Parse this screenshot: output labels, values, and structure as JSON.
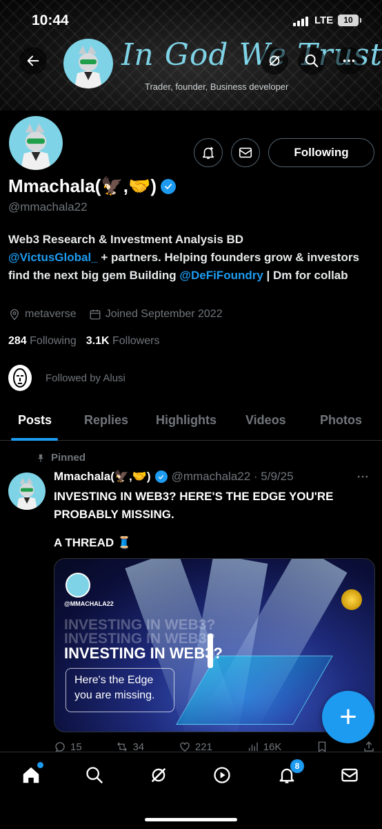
{
  "status_bar": {
    "time": "10:44",
    "network": "LTE",
    "battery": "10"
  },
  "banner": {
    "title": "In God We Trust",
    "subtitle": "Trader, founder, Business developer"
  },
  "header_actions": {
    "following_label": "Following"
  },
  "profile": {
    "name": "Mmachala(🦅,🤝)",
    "handle": "@mmachala22",
    "bio": {
      "line1": "Web3 Research & Investment Analysis BD",
      "mention1": "@VictusGlobal_",
      "text2": "+ partners. Helping founders grow & investors find the next big gem Building",
      "mention2": "@DeFiFoundry",
      "text3": "| Dm for collab"
    },
    "location": "metaverse",
    "joined": "Joined September 2022",
    "following_count": "284",
    "following_label": "Following",
    "followers_count": "3.1K",
    "followers_label": "Followers",
    "followed_by": "Followed by Alusi"
  },
  "tabs": [
    "Posts",
    "Replies",
    "Highlights",
    "Videos",
    "Photos"
  ],
  "post": {
    "pinned_label": "Pinned",
    "author": "Mmachala(🦅,🤝)",
    "handle_date": "@mmachala22 · 5/9/25",
    "text": "INVESTING IN WEB3? HERE'S THE EDGE YOU'RE PROBABLY MISSING.",
    "text2": "A THREAD 🧵",
    "media": {
      "handle": "@MMACHALA22",
      "ghost": "INVESTING IN WEB3?",
      "title": "INVESTING IN WEB3?",
      "box_line1": "Here's the Edge",
      "box_line2": "you are missing."
    },
    "replies": "15",
    "reposts": "34",
    "likes": "221",
    "views": "16K"
  },
  "fab_label": "+",
  "nav": {
    "notifications_badge": "8"
  },
  "colors": {
    "accent": "#1d9bf0",
    "banner_title": "#7fd3e6",
    "muted": "#71767b"
  }
}
